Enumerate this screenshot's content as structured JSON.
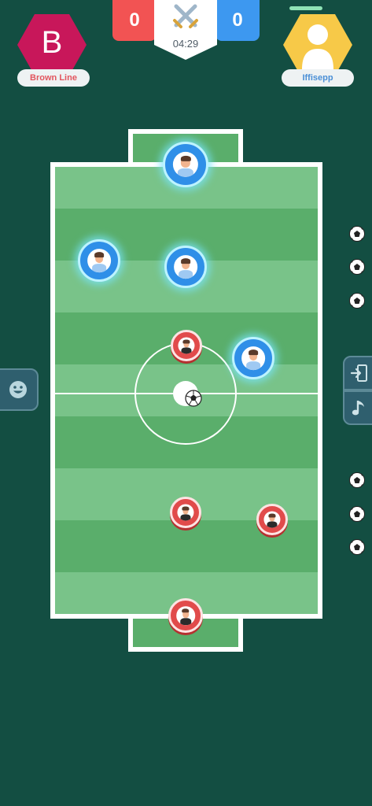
{
  "colors": {
    "background": "#134e42",
    "field_dark": "#5aae6b",
    "field_light": "#79c389",
    "team_left": "#c8175a",
    "team_right": "#f7c948",
    "score_red": "#f25353",
    "score_blue": "#3d98f0"
  },
  "player_left": {
    "avatar_letter": "B",
    "name": "Brown Line",
    "name_color": "#e2555e"
  },
  "player_right": {
    "name": "Iffisepp",
    "name_color": "#4a8fd6"
  },
  "scoreboard": {
    "left_score": "0",
    "right_score": "0",
    "time": "04:29",
    "emblem_icon": "crossed-swords-icon"
  },
  "side_controls": {
    "emoji_icon": "smiley-icon",
    "exit_icon": "exit-door-icon",
    "music_icon": "music-note-icon"
  },
  "remaining_balls": {
    "top_count": 3,
    "bottom_count": 3,
    "icon": "soccer-ball-icon"
  },
  "pieces": {
    "blue_team_count": 4,
    "red_team_count": 4
  }
}
